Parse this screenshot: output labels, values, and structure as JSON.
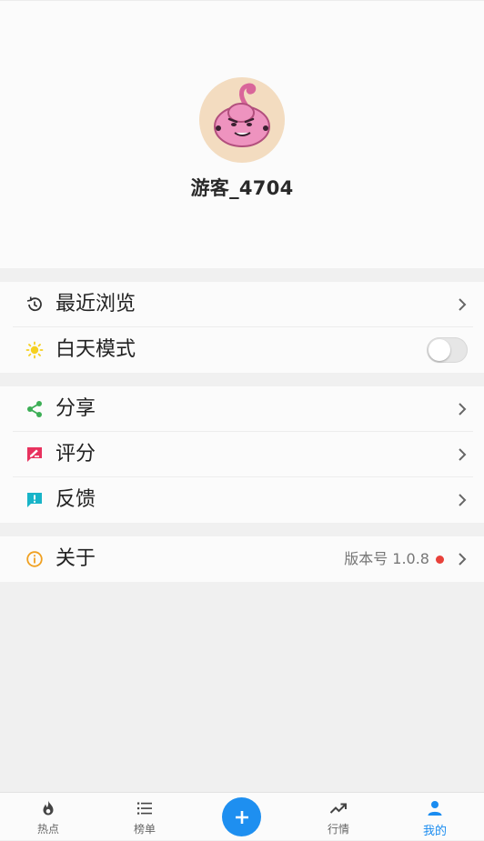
{
  "profile": {
    "username": "游客_4704"
  },
  "menu": {
    "recent": {
      "label": "最近浏览",
      "icon": "history-icon"
    },
    "daymode": {
      "label": "白天模式",
      "icon": "sun-icon",
      "toggle_on": false
    },
    "share": {
      "label": "分享",
      "icon": "share-icon"
    },
    "rate": {
      "label": "评分",
      "icon": "rate-icon"
    },
    "feedback": {
      "label": "反馈",
      "icon": "feedback-icon"
    },
    "about": {
      "label": "关于",
      "icon": "info-icon",
      "version": "版本号 1.0.8"
    }
  },
  "colors": {
    "accent": "#1e8ff0",
    "share": "#3cae55",
    "rate": "#e8325e",
    "feedback": "#18b4c8",
    "info": "#f0a020",
    "sun": "#f5d020",
    "dot": "#e8413a"
  },
  "tabs": [
    {
      "label": "热点",
      "icon": "flame-icon"
    },
    {
      "label": "榜单",
      "icon": "list-icon"
    },
    {
      "label": "",
      "icon": "plus-icon"
    },
    {
      "label": "行情",
      "icon": "trend-icon"
    },
    {
      "label": "我的",
      "icon": "person-icon"
    }
  ]
}
